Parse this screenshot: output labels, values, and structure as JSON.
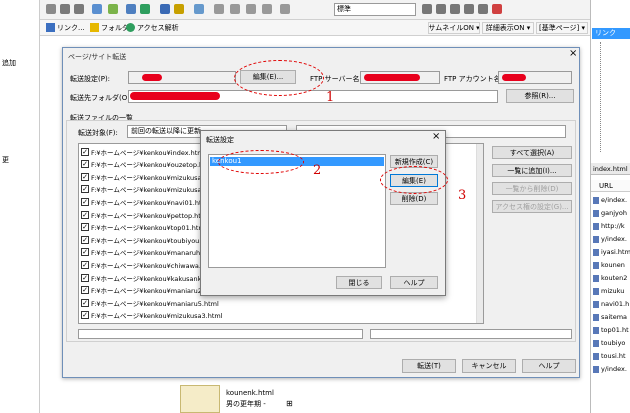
{
  "toolbar": {
    "link_label": "リンク...",
    "folder_label": "フォルダ",
    "access_label": "アクセス解析",
    "style_label": "標準",
    "thumb_label": "サムネイルON ▾",
    "detail_label": "詳細表示ON ▾",
    "base_label": "[基準ページ] ▾"
  },
  "left_fragments": {
    "a": "追加",
    "b": "更"
  },
  "dialog": {
    "title": "ページ/サイト転送",
    "transfer_setting_label": "転送設定(P):",
    "edit_button": "編集(E)...",
    "ftp_server_label": "FTP サーバー名",
    "ftp_account_label": "FTP アカウント名",
    "dest_folder_label": "転送先フォルダ(O)",
    "ref_button": "参照(R)...",
    "file_list_group": "転送ファイルの一覧",
    "target_label": "転送対象(F):",
    "target_value": "前回の転送以降に更新",
    "files": [
      "F:¥ホームページ¥kenkou¥index.html",
      "F:¥ホームページ¥kenkou¥ouzetop.html",
      "F:¥ホームページ¥kenkou¥mizukusa.html",
      "F:¥ホームページ¥kenkou¥mizukusa2.html",
      "F:¥ホームページ¥kenkou¥navi01.html",
      "F:¥ホームページ¥kenkou¥pettop.html",
      "F:¥ホームページ¥kenkou¥top01.html",
      "F:¥ホームページ¥kenkou¥toubiyou.html",
      "F:¥ホームページ¥kenkou¥manaruh.html",
      "F:¥ホームページ¥kenkou¥chiwawa.html",
      "F:¥ホームページ¥kenkou¥kakusank.html",
      "F:¥ホームページ¥kenkou¥maniaru2.html",
      "F:¥ホームページ¥kenkou¥maniaru5.html",
      "F:¥ホームページ¥kenkou¥mizukusa3.html"
    ],
    "select_all_button": "すべて選択(A)",
    "add_list_button": "一覧に追加(I)...",
    "remove_list_button": "一覧から削除(D)",
    "gen_button": "アクセス権の設定(G)...",
    "transfer_button": "転送(T)",
    "cancel_button": "キャンセル",
    "help_button": "ヘルプ"
  },
  "subdialog": {
    "title": "転送設定",
    "close_x": "×",
    "list_item": "kenkou1",
    "new_button": "新規作成(C)",
    "edit_button": "編集(E)",
    "delete_button": "削除(D)",
    "close_button": "閉じる",
    "help_button": "ヘルプ"
  },
  "annotations": {
    "n1": "1",
    "n2": "2",
    "n3": "3"
  },
  "right_panel": {
    "top_tab": "リンク",
    "panel_title": "index.html",
    "url_header": "URL",
    "urls": [
      "e/index.",
      "ganjyoh",
      "http://k",
      "y/index.",
      "iyasi.htm",
      "kounen",
      "kouten2",
      "mizuku",
      "navi01.h",
      "saitema",
      "top01.ht",
      "toubiyo",
      "tousi.ht",
      "y/index."
    ]
  },
  "bottom": {
    "thumb_file": "kounenk.html",
    "thumb_caption": "男の更年期 -",
    "plus": "⊞"
  },
  "colors": {
    "accent": "#e8001c",
    "selection": "#3399ff",
    "dialog_bg": "#f0f0f0"
  }
}
